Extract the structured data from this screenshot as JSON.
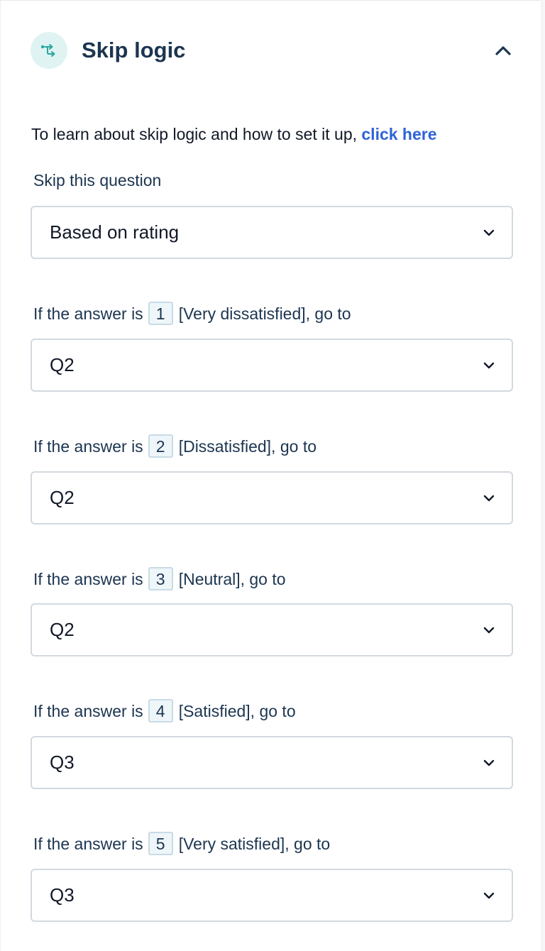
{
  "panel": {
    "title": "Skip logic",
    "icon": "branch-arrow-icon",
    "accent_color": "#2aa6a0",
    "icon_bg": "#dff3f3",
    "collapse_icon": "chevron-up-icon"
  },
  "intro": {
    "text": "To learn about skip logic and how to set it up, ",
    "link_text": "click here",
    "link_color": "#2f63d6"
  },
  "skip_mode": {
    "label": "Skip this question",
    "value": "Based on rating"
  },
  "rules": [
    {
      "prefix": "If the answer is",
      "rating": "1",
      "suffix": "[Very dissatisfied], go to",
      "target": "Q2"
    },
    {
      "prefix": "If the answer is",
      "rating": "2",
      "suffix": "[Dissatisfied], go to",
      "target": "Q2"
    },
    {
      "prefix": "If the answer is",
      "rating": "3",
      "suffix": "[Neutral], go to",
      "target": "Q2"
    },
    {
      "prefix": "If the answer is",
      "rating": "4",
      "suffix": "[Satisfied], go to",
      "target": "Q3"
    },
    {
      "prefix": "If the answer is",
      "rating": "5",
      "suffix": "[Very satisfied], go to",
      "target": "Q3"
    }
  ]
}
